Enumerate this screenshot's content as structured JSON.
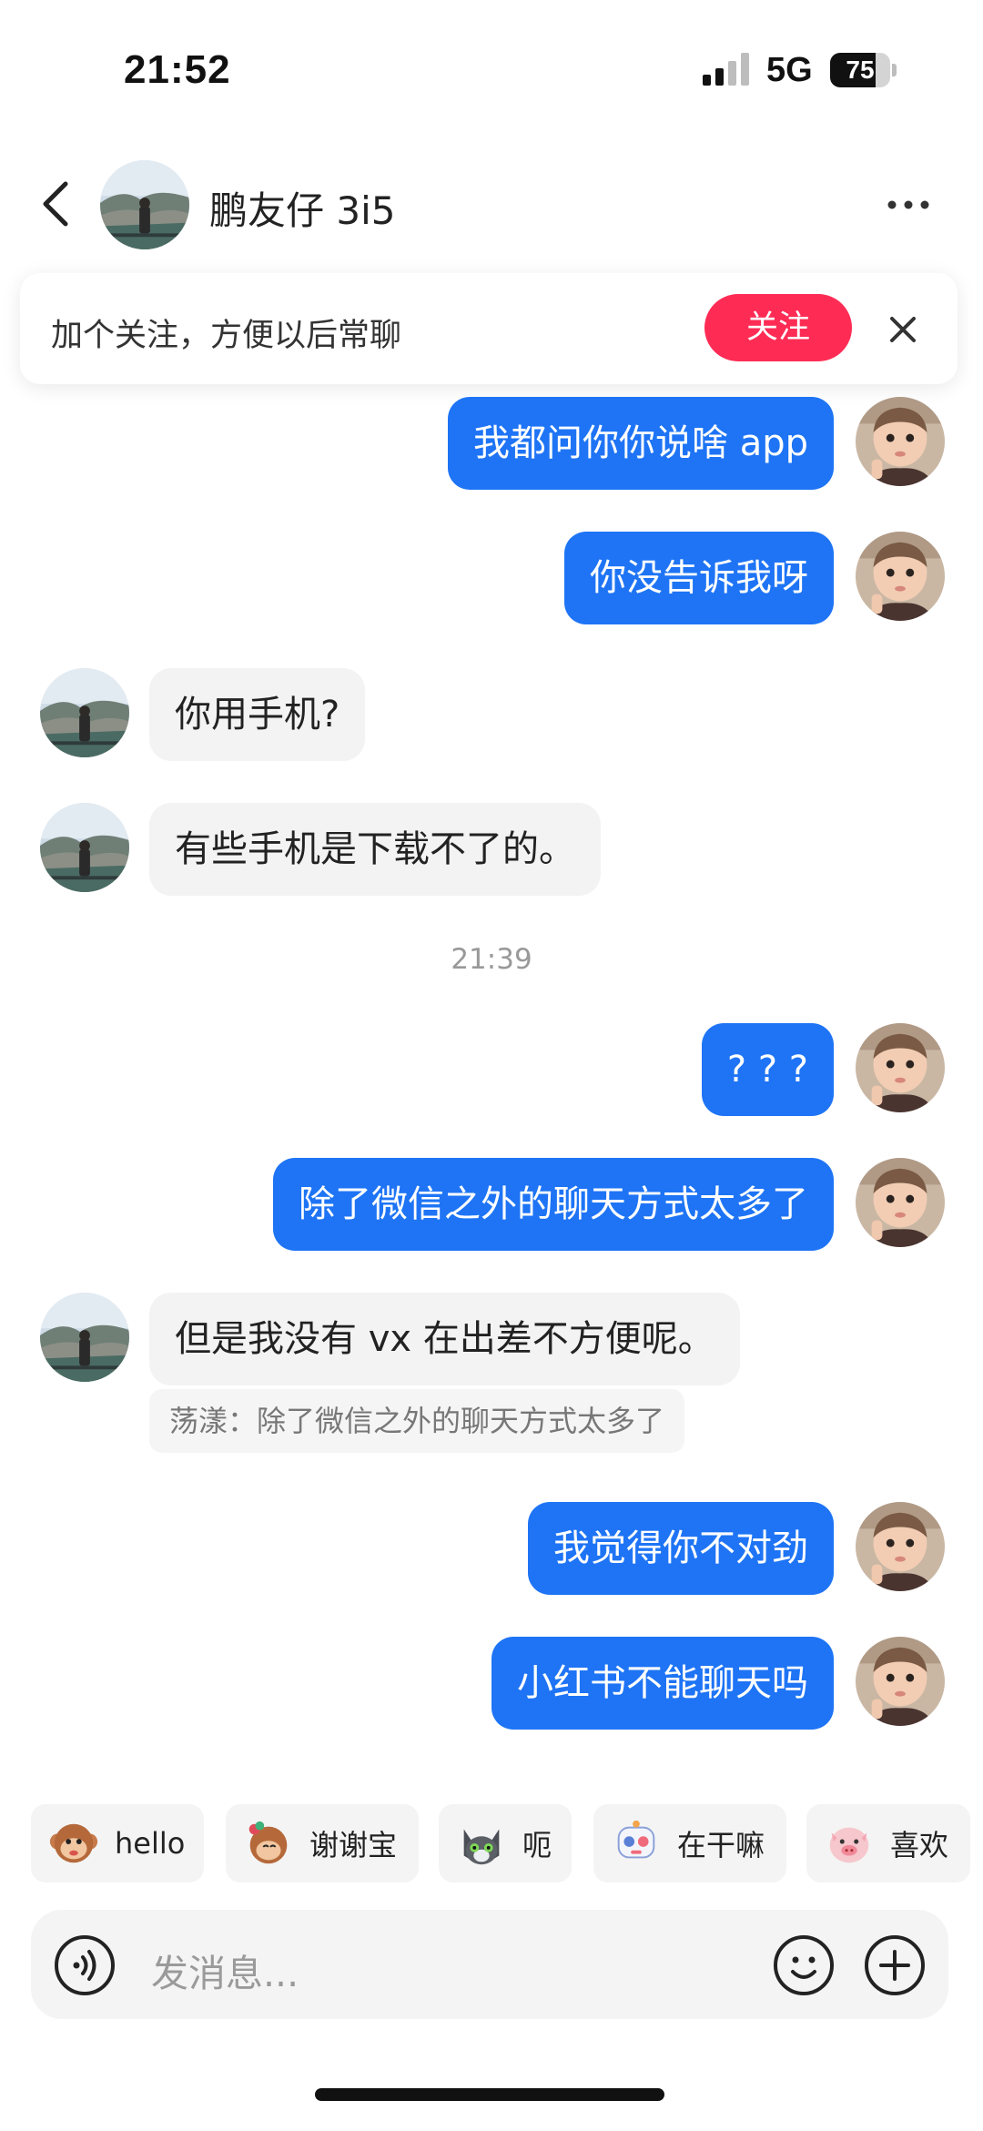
{
  "status_bar": {
    "time": "21:52",
    "network": "5G",
    "battery": "75",
    "battery_level": 0.75
  },
  "header": {
    "contact_name": "鹏友仔 3i5"
  },
  "banner": {
    "text": "加个关注，方便以后常聊",
    "follow_label": "关注"
  },
  "messages": [
    {
      "from": "me",
      "text": "我都问你你说啥 app"
    },
    {
      "from": "me",
      "text": "你没告诉我呀"
    },
    {
      "from": "them",
      "text": "你用手机?"
    },
    {
      "from": "them",
      "text": "有些手机是下载不了的。"
    },
    {
      "from": "me",
      "text": "? ? ?"
    },
    {
      "from": "me",
      "text": "除了微信之外的聊天方式太多了"
    },
    {
      "from": "them",
      "text": "但是我没有 vx 在出差不方便呢。",
      "quote": "荡漾：除了微信之外的聊天方式太多了"
    },
    {
      "from": "me",
      "text": "我觉得你不对劲"
    },
    {
      "from": "me",
      "text": "小红书不能聊天吗"
    }
  ],
  "timestamp": "21:39",
  "quick_replies": [
    {
      "label": "hello",
      "icon": "monkey-emoji-icon"
    },
    {
      "label": "谢谢宝",
      "icon": "monkey-bow-emoji-icon"
    },
    {
      "label": "呃",
      "icon": "cat-emoji-icon"
    },
    {
      "label": "在干嘛",
      "icon": "robot-emoji-icon"
    },
    {
      "label": "喜欢",
      "icon": "pig-emoji-icon"
    }
  ],
  "input": {
    "placeholder": "发消息..."
  },
  "colors": {
    "my_bubble": "#1e74f5",
    "their_bubble": "#f3f3f3",
    "follow_button": "#fe2c55"
  }
}
